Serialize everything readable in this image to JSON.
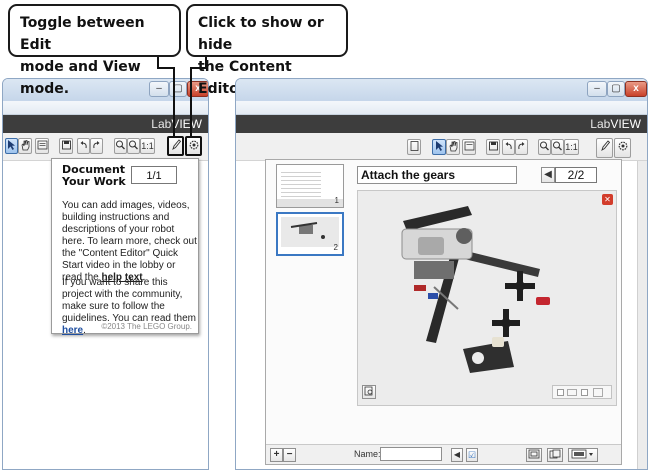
{
  "callouts": {
    "left": {
      "line1": "Toggle between Edit",
      "line2": "mode and View mode."
    },
    "right": {
      "line1": "Click to show or hide",
      "line2": "the Content Editor."
    }
  },
  "window_controls": {
    "minimize": "–",
    "maximize": "▢",
    "close": "x"
  },
  "brand": {
    "prefix": "Lab",
    "suffix": "VIEW"
  },
  "toolbar": {
    "zoom_fit_label": "1:1"
  },
  "popup": {
    "title_line1": "Document",
    "title_line2": "Your Work",
    "page_indicator": "1/1",
    "para1_text": "You can add images, videos, building instructions and descriptions of your robot here. To learn more, check out the \"Content Editor\" Quick Start video in the lobby or read the",
    "para1_link": "help text",
    "para1_end": ".",
    "para2_text": "If you want to share this project with the community, make sure to follow the guidelines. You can read them",
    "para2_link": "here",
    "para2_end": ".",
    "copyright": "©2013 The LEGO Group."
  },
  "editor": {
    "page_title": "Attach the gears",
    "page_indicator": "2/2",
    "thumbnails": [
      {
        "number": "1"
      },
      {
        "number": "2"
      }
    ],
    "name_label": "Name:",
    "name_value": "",
    "add_label": "+",
    "remove_label": "−",
    "prev_glyph": "◀",
    "check_glyph": "☑",
    "close_glyph": "✕"
  },
  "colors": {
    "accent_select": "#3b78c3",
    "labview_band": "#3d3d3d",
    "close_red": "#c9412a"
  }
}
